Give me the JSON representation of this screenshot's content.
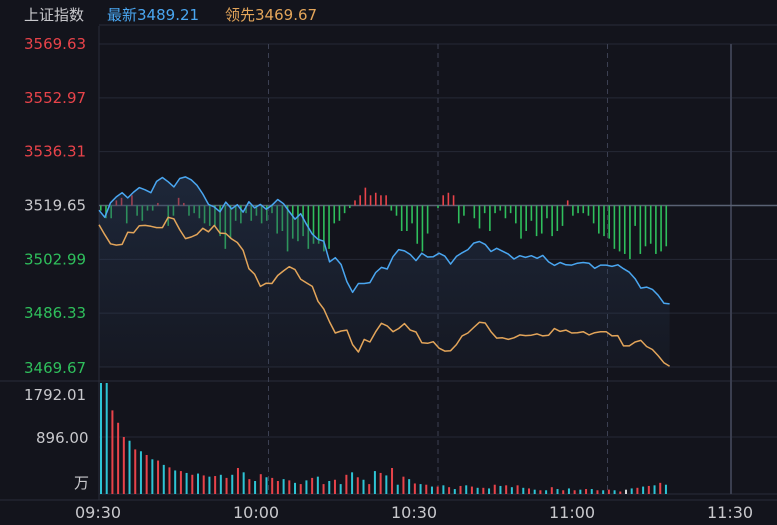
{
  "header": {
    "title": "上证指数",
    "latest_label": "最新",
    "latest_value": "3489.21",
    "lead_label": "领先",
    "lead_value": "3469.67"
  },
  "colors": {
    "background": "#13141c",
    "latest_line": "#4aa6f0",
    "lead_line": "#e3a55a",
    "up": "#e8434a",
    "down": "#2fbf5c",
    "flat": "#d6d6d6",
    "volume_cyan": "#2ec4d4"
  },
  "chart_data": {
    "type": "line",
    "price_axis": {
      "min": 3469.67,
      "max": 3569.63,
      "base": 3519.65,
      "ticks": [
        "3569.63",
        "3552.97",
        "3536.31",
        "3519.65",
        "3502.99",
        "3486.33",
        "3469.67"
      ]
    },
    "volume_axis": {
      "ticks": [
        "1792.01",
        "896.00"
      ],
      "unit": "万",
      "max": 1792.01
    },
    "time_axis": {
      "labels": [
        "09:30",
        "10:00",
        "10:30",
        "11:00",
        "11:30"
      ],
      "total_minutes": 120,
      "elapsed_minutes": 101
    },
    "series": [
      {
        "name": "最新",
        "values": [
          3518.2,
          3516.0,
          3520.5,
          3522.3,
          3523.6,
          3522.0,
          3523.8,
          3525.2,
          3524.5,
          3523.6,
          3527.1,
          3528.3,
          3527.0,
          3525.4,
          3528.0,
          3528.5,
          3527.6,
          3525.9,
          3523.2,
          3520.0,
          3519.2,
          3517.7,
          3520.7,
          3518.6,
          3519.9,
          3517.6,
          3520.8,
          3518.9,
          3520.0,
          3518.5,
          3519.7,
          3521.5,
          3520.2,
          3517.8,
          3515.4,
          3517.1,
          3513.8,
          3510.8,
          3509.2,
          3508.6,
          3502.2,
          3503.5,
          3501.4,
          3496.1,
          3492.8,
          3495.5,
          3495.5,
          3495.8,
          3498.9,
          3500.5,
          3500.0,
          3503.8,
          3506.0,
          3505.6,
          3504.5,
          3502.6,
          3504.9,
          3503.7,
          3503.8,
          3504.9,
          3504.0,
          3501.5,
          3503.9,
          3505.0,
          3506.0,
          3508.0,
          3508.5,
          3507.6,
          3505.4,
          3506.4,
          3505.5,
          3504.6,
          3503.1,
          3504.1,
          3503.6,
          3504.1,
          3503.3,
          3504.2,
          3502.2,
          3501.1,
          3502.0,
          3501.3,
          3501.2,
          3501.8,
          3502.0,
          3501.8,
          3500.2,
          3501.2,
          3501.2,
          3500.8,
          3501.3,
          3500.1,
          3499.0,
          3497.0,
          3494.1,
          3494.4,
          3493.7,
          3491.9,
          3489.4,
          3489.2
        ]
      },
      {
        "name": "领先",
        "values": [
          3513.7,
          3510.6,
          3507.8,
          3507.4,
          3507.6,
          3511.4,
          3511.2,
          3513.4,
          3513.5,
          3513.2,
          3512.8,
          3512.8,
          3516.0,
          3515.5,
          3512.2,
          3509.4,
          3509.9,
          3510.7,
          3512.6,
          3511.5,
          3513.5,
          3511.1,
          3511.0,
          3509.3,
          3508.2,
          3505.8,
          3500.1,
          3498.4,
          3494.6,
          3495.6,
          3495.5,
          3498.0,
          3499.4,
          3500.7,
          3499.8,
          3496.8,
          3495.7,
          3494.6,
          3490.0,
          3487.6,
          3483.6,
          3480.2,
          3480.8,
          3481.1,
          3476.6,
          3474.3,
          3478.2,
          3477.4,
          3480.6,
          3483.2,
          3482.4,
          3480.6,
          3481.6,
          3483.1,
          3481.1,
          3480.5,
          3477.2,
          3477.0,
          3477.5,
          3475.5,
          3474.6,
          3474.7,
          3476.6,
          3479.3,
          3480.2,
          3481.9,
          3483.5,
          3483.3,
          3480.6,
          3478.6,
          3478.7,
          3478.2,
          3478.7,
          3479.6,
          3479.4,
          3479.5,
          3479.9,
          3479.3,
          3479.5,
          3481.6,
          3480.7,
          3481.1,
          3480.2,
          3480.3,
          3480.6,
          3479.6,
          3480.3,
          3480.6,
          3480.6,
          3479.3,
          3479.4,
          3476.2,
          3476.2,
          3477.4,
          3477.9,
          3476.0,
          3475.1,
          3473.2,
          3471.0,
          3469.9
        ]
      }
    ],
    "breadth": [
      -2,
      -5,
      -5,
      2,
      3,
      -7,
      4,
      -4,
      -6,
      -2,
      -2,
      1,
      0,
      -8,
      -4,
      3,
      1,
      -4,
      -3,
      -5,
      -7,
      -8,
      -8,
      -12,
      -17,
      -13,
      -6,
      -7,
      -3,
      -6,
      -4,
      -7,
      -6,
      -3,
      -11,
      -10,
      -18,
      -13,
      -14,
      -12,
      -17,
      -15,
      -15,
      -18,
      -17,
      -7,
      -6,
      -3,
      -1,
      2,
      4,
      7,
      4,
      5,
      4,
      4,
      -2,
      -4,
      -10,
      -10,
      -7,
      -15,
      -18,
      -11,
      0,
      -1,
      4,
      5,
      4,
      -7,
      -4,
      0,
      -5,
      -9,
      -3,
      -10,
      -3,
      -2,
      -5,
      -3,
      -7,
      -13,
      -10,
      -6,
      -12,
      -11,
      -5,
      -12,
      -10,
      -8,
      2,
      -4,
      -3,
      -3,
      -4,
      -7,
      -11,
      -12,
      -13,
      -17,
      -18,
      -19,
      -21,
      -8,
      -19,
      -16,
      -15,
      -19,
      -18,
      -16
    ],
    "volume": [
      1792.01,
      1792.01,
      1350,
      1150,
      920,
      860,
      720,
      690,
      630,
      560,
      540,
      470,
      430,
      380,
      370,
      340,
      310,
      330,
      300,
      280,
      290,
      310,
      260,
      310,
      420,
      350,
      240,
      210,
      320,
      270,
      260,
      210,
      240,
      220,
      180,
      160,
      220,
      260,
      280,
      160,
      210,
      230,
      160,
      310,
      350,
      270,
      230,
      160,
      370,
      340,
      300,
      420,
      150,
      280,
      240,
      170,
      160,
      150,
      120,
      120,
      140,
      110,
      80,
      130,
      140,
      120,
      100,
      100,
      90,
      150,
      130,
      140,
      110,
      140,
      100,
      90,
      70,
      60,
      60,
      110,
      80,
      60,
      90,
      60,
      70,
      80,
      80,
      60,
      60,
      70,
      60,
      40,
      70,
      90,
      100,
      120,
      130,
      140,
      180,
      150
    ],
    "volume_colors": [
      "c",
      "c",
      "r",
      "r",
      "r",
      "c",
      "r",
      "c",
      "r",
      "c",
      "r",
      "c",
      "r",
      "c",
      "r",
      "c",
      "r",
      "c",
      "r",
      "c",
      "r",
      "c",
      "r",
      "c",
      "r",
      "c",
      "r",
      "c",
      "r",
      "c",
      "r",
      "r",
      "c",
      "r",
      "c",
      "r",
      "c",
      "r",
      "c",
      "r",
      "c",
      "r",
      "c",
      "r",
      "c",
      "r",
      "c",
      "r",
      "c",
      "r",
      "c",
      "r",
      "c",
      "r",
      "c",
      "r",
      "c",
      "r",
      "c",
      "r",
      "c",
      "r",
      "c",
      "r",
      "c",
      "r",
      "c",
      "r",
      "c",
      "r",
      "c",
      "r",
      "c",
      "r",
      "c",
      "r",
      "c",
      "r",
      "c",
      "r",
      "c",
      "r",
      "c",
      "r",
      "c",
      "r",
      "c",
      "r",
      "c",
      "r",
      "c",
      "r",
      "w",
      "c",
      "r",
      "c",
      "r",
      "c",
      "r",
      "c"
    ]
  }
}
